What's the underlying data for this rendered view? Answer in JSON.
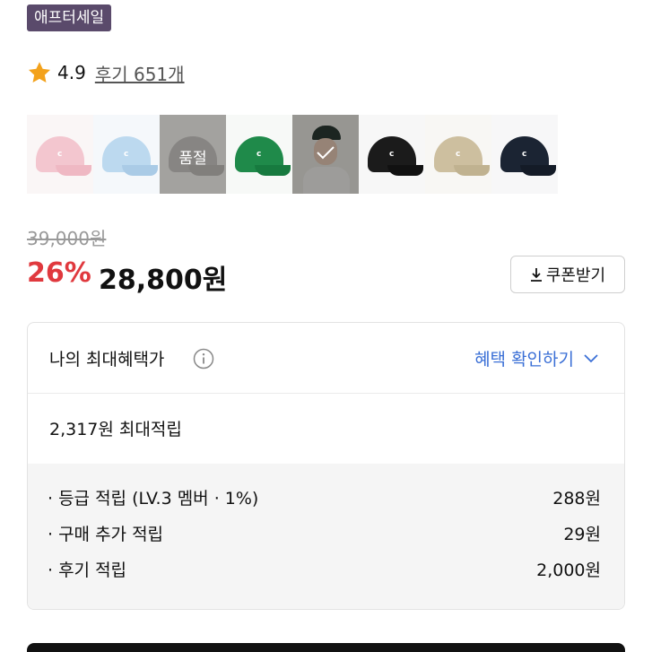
{
  "badge": {
    "label": "애프터세일"
  },
  "rating": {
    "score": "4.9",
    "review_link": "후기 651개"
  },
  "colors": {
    "accent": "#3a6fd6",
    "discount": "#e0393e",
    "star": "#f3a21c"
  },
  "thumbnails": [
    {
      "name": "pink",
      "color": "#f3c6cf",
      "status": ""
    },
    {
      "name": "sky-blue",
      "color": "#bcd9ef",
      "status": ""
    },
    {
      "name": "grey",
      "color": "#9a9690",
      "status": "품절"
    },
    {
      "name": "green",
      "color": "#1f8a4a",
      "status": ""
    },
    {
      "name": "model-dark-green",
      "color": "#2c3a34",
      "status": "selected"
    },
    {
      "name": "black",
      "color": "#1b1b1b",
      "status": ""
    },
    {
      "name": "beige",
      "color": "#cdbf9f",
      "status": ""
    },
    {
      "name": "navy",
      "color": "#1b2433",
      "status": ""
    }
  ],
  "price": {
    "original": "39,000원",
    "discount_rate": "26%",
    "sale": "28,800원"
  },
  "coupon": {
    "label": "쿠폰받기"
  },
  "benefits": {
    "title": "나의 최대혜택가",
    "toggle_label": "혜택 확인하기",
    "points_total": "2,317원 최대적립",
    "rows": [
      {
        "label": "· 등급 적립 (LV.3 멤버 · 1%)",
        "value": "288원"
      },
      {
        "label": "· 구매 추가 적립",
        "value": "29원"
      },
      {
        "label": "· 후기 적립",
        "value": "2,000원"
      }
    ]
  }
}
